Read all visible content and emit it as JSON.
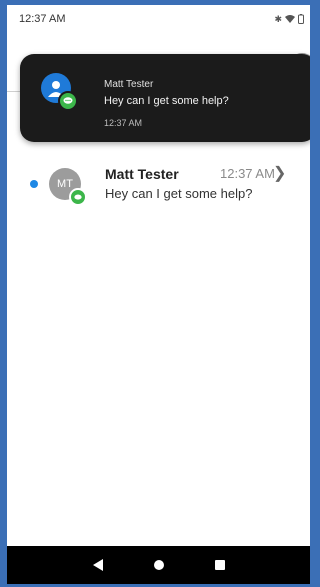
{
  "status_bar": {
    "time": "12:37 AM",
    "icons": [
      "bluetooth-icon",
      "wifi-icon",
      "battery-icon"
    ]
  },
  "notification": {
    "sender": "Matt Tester",
    "message": "Hey can I get some help?",
    "time": "12:37 AM",
    "avatar_color": "#1f7ad8",
    "badge_color": "#3cb64a"
  },
  "conversation": {
    "initials": "MT",
    "name": "Matt Tester",
    "time": "12:37 AM",
    "preview": "Hey can I get some help?",
    "unread_color": "#1e88e5",
    "badge_color": "#3cb64a"
  },
  "nav": {
    "icons": [
      "back-icon",
      "home-icon",
      "recents-icon"
    ]
  }
}
